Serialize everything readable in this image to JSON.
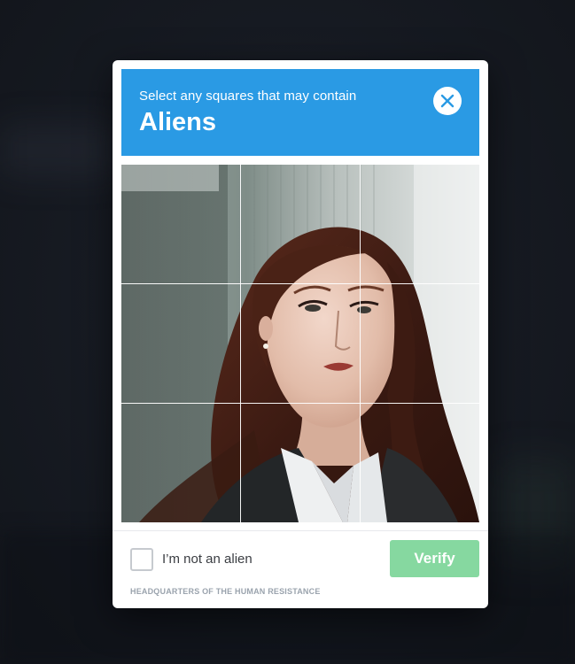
{
  "challenge": {
    "prompt": "Select any squares that may contain",
    "target": "Aliens",
    "accent_color": "#2a9ae4"
  },
  "close_button": {
    "icon": "close-icon",
    "color": "#2a9ae4"
  },
  "grid": {
    "rows": 3,
    "columns": 3,
    "tiles": [
      {
        "row": 1,
        "col": 1,
        "selected": false
      },
      {
        "row": 1,
        "col": 2,
        "selected": false
      },
      {
        "row": 1,
        "col": 3,
        "selected": false
      },
      {
        "row": 2,
        "col": 1,
        "selected": false
      },
      {
        "row": 2,
        "col": 2,
        "selected": false
      },
      {
        "row": 2,
        "col": 3,
        "selected": false
      },
      {
        "row": 3,
        "col": 1,
        "selected": false
      },
      {
        "row": 3,
        "col": 2,
        "selected": false
      },
      {
        "row": 3,
        "col": 3,
        "selected": false
      }
    ]
  },
  "confirmation": {
    "checkbox_label": "I’m not an alien",
    "checked": false
  },
  "verify": {
    "label": "Verify",
    "color": "#86d8a0"
  },
  "footer": {
    "text": "HEADQUARTERS OF THE HUMAN RESISTANCE"
  }
}
